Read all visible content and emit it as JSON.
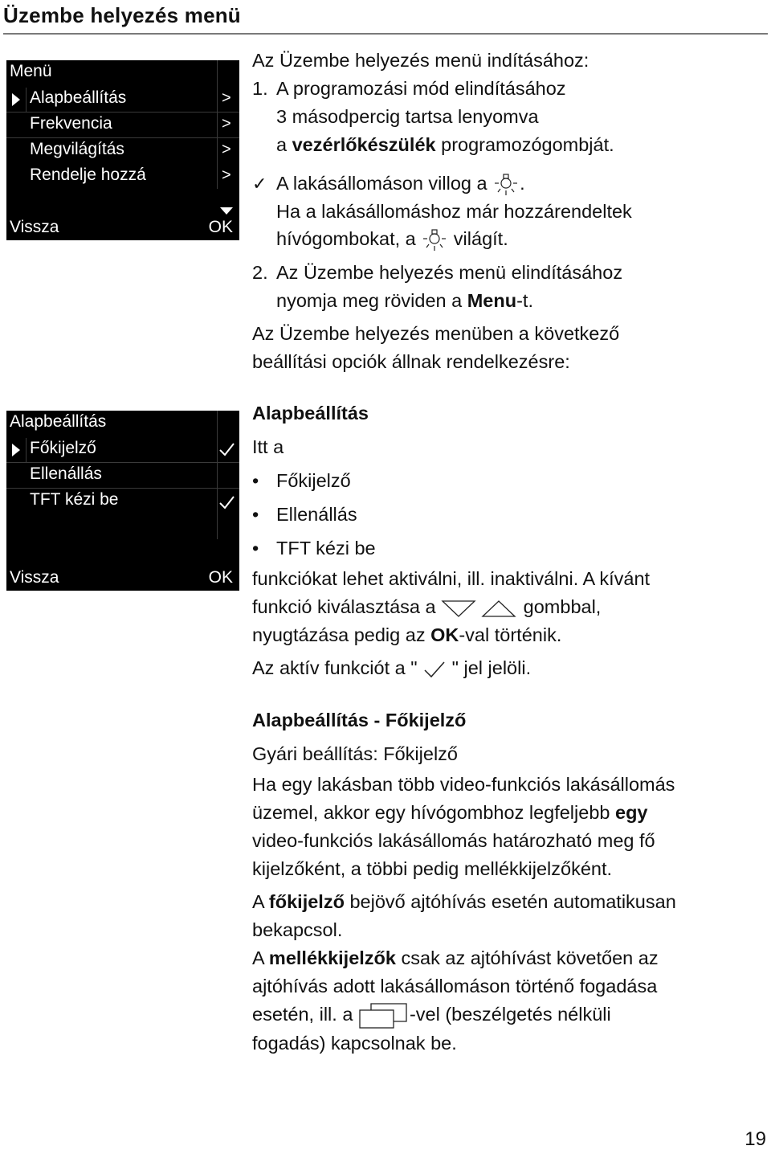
{
  "page": {
    "title": "Üzembe helyezés menü",
    "page_number": "19"
  },
  "screen_main_menu": {
    "title": "Menü",
    "items": [
      {
        "label": "Alapbeállítás",
        "indicator": ">",
        "selected": true
      },
      {
        "label": "Frekvencia",
        "indicator": ">"
      },
      {
        "label": "Megvilágítás",
        "indicator": ">"
      },
      {
        "label": "Rendelje hozzá",
        "indicator": ">"
      }
    ],
    "back_label": "Vissza",
    "ok_label": "OK",
    "scroll_icon": "triangle-down-icon"
  },
  "screen_basic_settings": {
    "title": "Alapbeállítás",
    "items": [
      {
        "label": "Főkijelző",
        "checked": true,
        "selected": true
      },
      {
        "label": "Ellenállás",
        "checked": false
      },
      {
        "label": "TFT kézi be",
        "checked": true
      }
    ],
    "back_label": "Vissza",
    "ok_label": "OK",
    "check_icon": "checkmark-icon"
  },
  "intro": {
    "line": "Az Üzembe helyezés menü indításához:",
    "step1": {
      "num": "1.",
      "line1": "A programozási mód elindításához",
      "line2": "3 másodpercig tartsa lenyomva",
      "line3_pre": "a ",
      "line3_bold": "vezérlőkészülék",
      "line3_post": " programozógombját."
    },
    "result": {
      "mark": "✓",
      "line1_pre": "A lakásállomáson villog a ",
      "line1_post": ".",
      "line2": "Ha a lakásállomáshoz már hozzárendeltek",
      "line3_pre": "hívógombokat, a ",
      "line3_post": " világít.",
      "icon": "lamp-icon"
    },
    "step2": {
      "num": "2.",
      "line1": "Az Üzembe helyezés menü elindításához",
      "line2_pre": "nyomja meg röviden a ",
      "line2_bold": "Menu",
      "line2_post": "-t."
    },
    "options_line1": "Az Üzembe helyezés menüben a következő",
    "options_line2": "beállítási opciók állnak rendelkezésre:"
  },
  "section_basic": {
    "heading": "Alapbeállítás",
    "lead": "Itt a",
    "bullets": [
      "Főkijelző",
      "Ellenállás",
      "TFT kézi be"
    ],
    "p1_line1": "funkciókat lehet aktiválni, ill. inaktiválni. A kívánt",
    "p1_line2_pre": "funkció kiválasztása a ",
    "p1_line2_post": " gombbal,",
    "p1_line3_pre": "nyugtázása pedig az ",
    "p1_line3_bold": "OK",
    "p1_line3_post": "-val történik.",
    "p2_pre": "Az aktív funkciót a \" ",
    "p2_post": " \" jel jelöli.",
    "arrow_icons": [
      "triangle-down-outline-icon",
      "triangle-up-outline-icon"
    ]
  },
  "section_main_display": {
    "heading": "Alapbeállítás - Főkijelző",
    "factory": "Gyári beállítás: Főkijelző",
    "p1_line1": "Ha egy lakásban több video-funkciós lakásállomás",
    "p1_line2_pre": "üzemel, akkor egy hívógombhoz legfeljebb ",
    "p1_line2_bold": "egy",
    "p1_line3": "video-funkciós lakásállomás határozható meg fő",
    "p1_line4": "kijelzőként, a többi pedig mellékkijelzőként.",
    "p2_line1_pre": "A ",
    "p2_line1_bold": "főkijelző",
    "p2_line1_post": " bejövő ajtóhívás esetén automatikusan",
    "p2_line2": "bekapcsol.",
    "p3_line1_pre": "A ",
    "p3_line1_bold": "mellékkijelzők",
    "p3_line1_post": " csak az ajtóhívást követően az",
    "p3_line2": "ajtóhívás adott lakásállomáson történő fogadása",
    "p3_line3_pre": "esetén, ill. a ",
    "p3_line3_post": "-vel (beszélgetés nélküli",
    "p3_line4": "fogadás) kapcsolnak be.",
    "screen_icon": "display-windows-icon"
  }
}
